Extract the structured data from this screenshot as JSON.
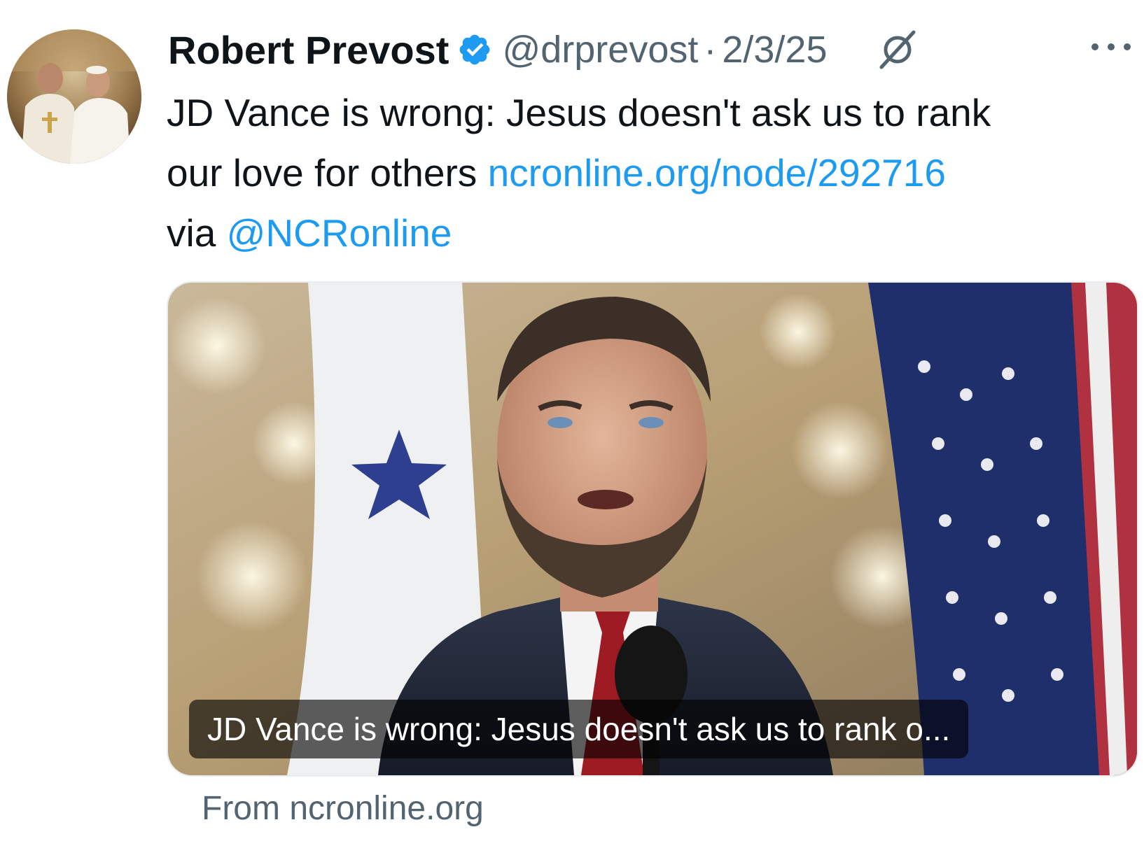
{
  "tweet": {
    "author_name": "Robert Prevost",
    "handle": "@drprevost",
    "separator": "·",
    "date": "2/3/25",
    "verified_color": "#1d9bf0",
    "text_line1": "JD Vance is wrong: Jesus doesn't ask us to rank",
    "text_line2_prefix": "our love for others ",
    "link_url_text": "ncronline.org/node/292716",
    "text_line3_prefix": "via ",
    "mention": "@NCRonline",
    "link_color": "#1d9bf0"
  },
  "card": {
    "caption": "JD Vance is wrong: Jesus doesn't ask us to rank o...",
    "source": "From ncronline.org"
  },
  "icons": {
    "verified": "verified-badge-icon",
    "grok": "grok-icon",
    "more": "more-options-icon"
  }
}
